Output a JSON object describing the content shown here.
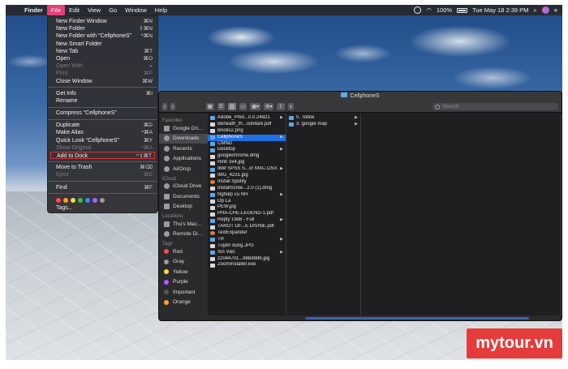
{
  "menubar": {
    "app": "Finder",
    "items": [
      "File",
      "Edit",
      "View",
      "Go",
      "Window",
      "Help"
    ],
    "right": {
      "battery": "100%",
      "datetime": "Tue May 18  2:39 PM"
    }
  },
  "file_menu": {
    "items": [
      {
        "label": "New Finder Window",
        "shortcut": "⌘N"
      },
      {
        "label": "New Folder",
        "shortcut": "⇧⌘N"
      },
      {
        "label": "New Folder with “CellphoneS”",
        "shortcut": "^⌘N"
      },
      {
        "label": "New Smart Folder",
        "shortcut": ""
      },
      {
        "label": "New Tab",
        "shortcut": "⌘T"
      },
      {
        "label": "Open",
        "shortcut": "⌘O"
      },
      {
        "label": "Open With",
        "shortcut": "▸"
      },
      {
        "label": "Print",
        "shortcut": "⌘P"
      },
      {
        "label": "Close Window",
        "shortcut": "⌘W"
      },
      {
        "label": "Get Info",
        "shortcut": "⌘I"
      },
      {
        "label": "Rename",
        "shortcut": ""
      },
      {
        "label": "Compress “CellphoneS”",
        "shortcut": ""
      },
      {
        "label": "Duplicate",
        "shortcut": "⌘D"
      },
      {
        "label": "Make Alias",
        "shortcut": "^⌘A"
      },
      {
        "label": "Quick Look “CellphoneS”",
        "shortcut": "⌘Y"
      },
      {
        "label": "Show Original",
        "shortcut": "^⌘A"
      },
      {
        "label": "Add to Dock",
        "shortcut": "^⇧⌘T"
      },
      {
        "label": "Move to Trash",
        "shortcut": "⌘⌫"
      },
      {
        "label": "Eject",
        "shortcut": "⌘E"
      },
      {
        "label": "Find",
        "shortcut": "⌘F"
      },
      {
        "label": "Tags...",
        "shortcut": ""
      }
    ],
    "tag_colors": [
      "#ff4a4a",
      "#ff9d2a",
      "#ffd83a",
      "#3ac24a",
      "#3a8cff",
      "#b45cff",
      "#9a9aa0"
    ]
  },
  "finder": {
    "title": "CellphoneS",
    "search_placeholder": "Search",
    "sidebar": {
      "favorites_header": "Favorites",
      "favorites": [
        "Google Dri...",
        "Downloads",
        "Recents",
        "Applications",
        "AirDrop"
      ],
      "icloud_header": "iCloud",
      "icloud": [
        "iCloud Drive",
        "Documents",
        "Desktop"
      ],
      "locations_header": "Locations",
      "locations": [
        "Thu's Mac...",
        "Remote Di..."
      ],
      "tags_header": "Tags",
      "tags": [
        {
          "label": "Red",
          "color": "#ff4a4a"
        },
        {
          "label": "Gray",
          "color": "#9a9aa0"
        },
        {
          "label": "Yellow",
          "color": "#ffd83a"
        },
        {
          "label": "Purple",
          "color": "#b45cff"
        },
        {
          "label": "Important",
          "color": "#555558"
        },
        {
          "label": "Orange",
          "color": "#ff9d2a"
        }
      ]
    },
    "column1": [
      {
        "name": "Adobe_Phot...0.0.24821",
        "kind": "folder",
        "arrow": true
      },
      {
        "name": "Beneath_th...oshitani.pdf",
        "kind": "file"
      },
      {
        "name": "Books2.png",
        "kind": "file"
      },
      {
        "name": "CellphoneS",
        "kind": "folder",
        "arrow": true,
        "selected": true
      },
      {
        "name": "CMND",
        "kind": "folder"
      },
      {
        "name": "Desktop",
        "kind": "folder",
        "arrow": true
      },
      {
        "name": "googlechrome.dmg",
        "kind": "file"
      },
      {
        "name": "Hinh 3x4.jpg",
        "kind": "file"
      },
      {
        "name": "IBM SPSS S...or MAC.OSX",
        "kind": "folder",
        "arrow": true
      },
      {
        "name": "IMG_4231.jpg",
        "kind": "file"
      },
      {
        "name": "Install Spotify",
        "kind": "app"
      },
      {
        "name": "InstallScree...2.0 (1).dmg",
        "kind": "file"
      },
      {
        "name": "Nghiệp vụ NH",
        "kind": "folder",
        "arrow": true
      },
      {
        "name": "Ốp La",
        "kind": "file"
      },
      {
        "name": "PEW.jpg",
        "kind": "file"
      },
      {
        "name": "PHA-CHE-LEGEND-1.pdf",
        "kind": "file"
      },
      {
        "name": "Reply 1988 - Full",
        "kind": "folder",
        "arrow": true
      },
      {
        "name": "TAROT OF...E DIVINE.pdf",
        "kind": "file"
      },
      {
        "name": "TextExpander",
        "kind": "app"
      },
      {
        "name": "TR",
        "kind": "folder",
        "arrow": true
      },
      {
        "name": "Tuyển dụng.JPG",
        "kind": "file"
      },
      {
        "name": "Xin Việc",
        "kind": "folder",
        "arrow": true
      },
      {
        "name": "z2044701...888d9db.jpg",
        "kind": "file"
      },
      {
        "name": "ZoomInstaller.exe",
        "kind": "file"
      }
    ],
    "column2": [
      {
        "name": "0. Tiktok",
        "kind": "folder",
        "arrow": true
      },
      {
        "name": "3. google map",
        "kind": "folder",
        "arrow": true
      }
    ]
  },
  "watermark": "mytour.vn"
}
